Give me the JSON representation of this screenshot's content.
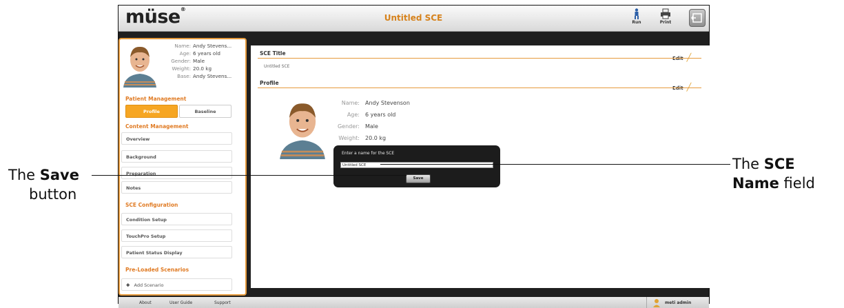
{
  "app": {
    "logo": "müse",
    "logo_reg": "®",
    "title": "Untitled SCE",
    "run_label": "Run",
    "print_label": "Print"
  },
  "patient": {
    "fields": [
      {
        "k": "Name:",
        "v": "Andy Stevens..."
      },
      {
        "k": "Age:",
        "v": "6 years old"
      },
      {
        "k": "Gender:",
        "v": "Male"
      },
      {
        "k": "Weight:",
        "v": "20.0 kg"
      },
      {
        "k": "Base:",
        "v": "Andy Stevens..."
      }
    ]
  },
  "sidebar": {
    "patient_mgmt": "Patient Management",
    "profile_btn": "Profile",
    "baseline_btn": "Baseline",
    "content_mgmt": "Content Management",
    "content_items": [
      "Overview",
      "Background",
      "Preparation",
      "Notes"
    ],
    "sce_config": "SCE Configuration",
    "config_items": [
      "Condition Setup",
      "TouchPro Setup",
      "Patient Status Display"
    ],
    "preloaded": "Pre-Loaded Scenarios",
    "add_scenario": "Add Scenario"
  },
  "main": {
    "sce_title_label": "SCE Title",
    "sce_title_value": "Untitled SCE",
    "profile_label": "Profile",
    "edit_label": "Edit",
    "profile_fields": [
      {
        "k": "Name:",
        "v": "Andy Stevenson"
      },
      {
        "k": "Age:",
        "v": "6 years old"
      },
      {
        "k": "Gender:",
        "v": "Male"
      },
      {
        "k": "Weight:",
        "v": "20.0 kg"
      }
    ]
  },
  "dialog": {
    "prompt": "Enter a name for the SCE",
    "input_value": "Untitled SCE",
    "save_label": "Save"
  },
  "footer": {
    "links": [
      "About",
      "User Guide",
      "Support"
    ],
    "user": "meti admin"
  },
  "callouts": {
    "save_pre": "The ",
    "save_bold": "Save",
    "save_line2": "button",
    "name_pre": "The ",
    "name_bold": "SCE",
    "name_line2_bold": "Name",
    "name_line2_rest": " field"
  },
  "colors": {
    "accent": "#e69a3c",
    "title": "#d6821c",
    "dark": "#1f1f1f"
  }
}
